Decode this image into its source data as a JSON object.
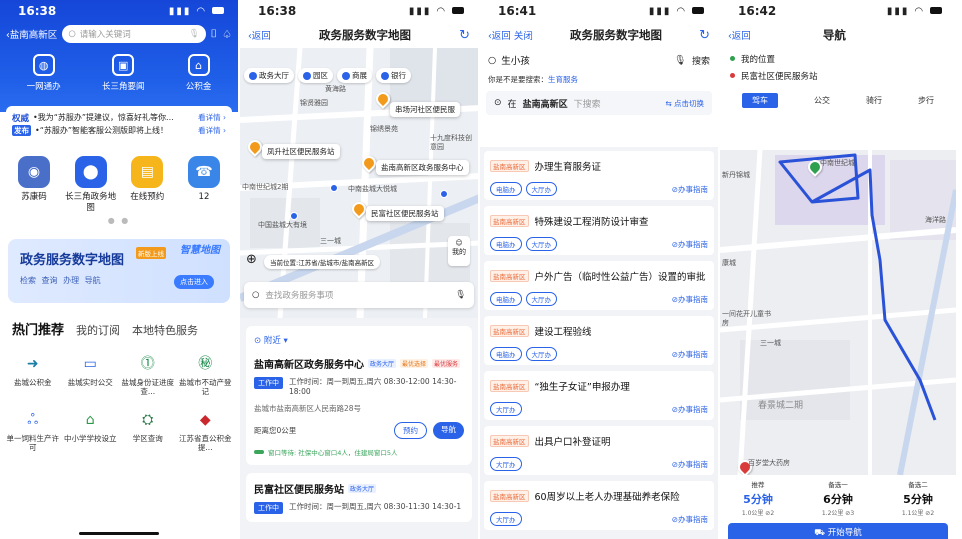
{
  "p1": {
    "time": "16:38",
    "region": "‹盐南高新区",
    "search_placeholder": "请输入关键词",
    "top_icons": [
      {
        "label": "一网通办",
        "icon": "globe-icon",
        "glyph": "◍"
      },
      {
        "label": "长三角要闻",
        "icon": "phone-news-icon",
        "glyph": "▣"
      },
      {
        "label": "公积金",
        "icon": "fund-icon",
        "glyph": "⌂"
      }
    ],
    "news": [
      {
        "tag": "权威",
        "text": "•我为“苏服办”提建议，惊喜好礼等你...",
        "link": "看详情 ›"
      },
      {
        "tag": "发布",
        "text": "•“苏服办”智能客服公测版即将上线！",
        "link": "看详情 ›"
      }
    ],
    "apps": [
      {
        "label": "苏康码",
        "color": "#4a6fc9",
        "glyph": "◉",
        "icon": "health-code-icon"
      },
      {
        "label": "长三角政务地图",
        "color": "#2a62e8",
        "glyph": "⬤",
        "icon": "map-icon"
      },
      {
        "label": "在线预约",
        "color": "#f5b51b",
        "glyph": "▤",
        "icon": "calendar-icon"
      },
      {
        "label": "12",
        "color": "#3a86e8",
        "glyph": "☎",
        "icon": "hotline-icon"
      }
    ],
    "banner": {
      "title": "政务服务数字地图",
      "tag": "新版上线",
      "sub": "检索 查询 办理 导航",
      "button": "点击进入",
      "logo": "智慧地图"
    },
    "tabs": [
      "热门推荐",
      "我的订阅",
      "本地特色服务"
    ],
    "grid": [
      {
        "label": "盐城公积金",
        "glyph": "➜",
        "color": "#1c7fa8",
        "icon": "fund-arrow-icon"
      },
      {
        "label": "盐城实时公交",
        "glyph": "▭",
        "color": "#2a62e8",
        "icon": "bus-icon"
      },
      {
        "label": "盐城身份证进度查...",
        "glyph": "⓵",
        "color": "#1a8a4a",
        "icon": "id-card-icon"
      },
      {
        "label": "盐城市不动产登记",
        "glyph": "㊙",
        "color": "#1a8a4a",
        "icon": "estate-icon"
      },
      {
        "label": "单一饲料生产许可",
        "glyph": "ஃ",
        "color": "#2a62e8",
        "icon": "feed-icon"
      },
      {
        "label": "中小学学校设立",
        "glyph": "⌂",
        "color": "#2a9a4a",
        "icon": "school-icon"
      },
      {
        "label": "学区查询",
        "glyph": "⛭",
        "color": "#2a7a4a",
        "icon": "district-icon"
      },
      {
        "label": "江苏省直公积金提...",
        "glyph": "◆",
        "color": "#c9282d",
        "icon": "province-fund-icon"
      }
    ]
  },
  "p2": {
    "time": "16:38",
    "back": "‹返回",
    "title": "政务服务数字地图",
    "filters": [
      "政务大厅",
      "园区",
      "商展",
      "银行"
    ],
    "map_labels": [
      "串场河社区便民服",
      "凤升社区便民服务站",
      "盐南高新区政务服务中心",
      "民富社区便民服务站"
    ],
    "pois": [
      "黄海路",
      "锦贤雅园",
      "锦绣景苑",
      "十九度科技创意园",
      "中南世纪城2期",
      "中南盐城大悦城",
      "中国盐城大有境",
      "三一城"
    ],
    "mine": "我的",
    "location": "当前位置:江苏省/盐城市/盐南高新区",
    "search_placeholder": "查找政务服务事项",
    "nearby": "附近 ▾",
    "cards": [
      {
        "name": "盐南高新区政务服务中心",
        "tags": [
          "政务大厅",
          "最优选择",
          "最优服务"
        ],
        "work_tag": "工作中",
        "hours": "工作时间：周一到周五,周六 08:30-12:00 14:30-18:00",
        "address": "盐城市盐南高新区人民南路28号",
        "distance": "距离您0公里",
        "btn1": "预约",
        "btn2": "导航",
        "queue": "窗口等待: 社保中心窗口4人，住建局窗口5人"
      },
      {
        "name": "民富社区便民服务站",
        "tags": [
          "政务大厅"
        ],
        "work_tag": "工作中",
        "hours": "工作时间：周一到周五,周六 08:30-11:30 14:30-1"
      }
    ]
  },
  "p3": {
    "time": "16:41",
    "back": "‹返回",
    "close": "关闭",
    "title": "政务服务数字地图",
    "query": "生小孩",
    "search_btn": "搜索",
    "suggest_prefix": "你是不是要搜索：",
    "suggest_term": "生育服务",
    "loc_prefix": "在",
    "loc_region": "盐南高新区",
    "loc_hint": "下搜索",
    "loc_switch": "⇆ 点击切换",
    "region_tag": "盐南高新区",
    "guide": "⊘办事指南",
    "items": [
      {
        "title": "办理生育服务证",
        "pills": [
          "电脑办",
          "大厅办"
        ]
      },
      {
        "title": "特殊建设工程消防设计审查",
        "pills": [
          "电脑办",
          "大厅办"
        ]
      },
      {
        "title": "户外广告（临时性公益广告）设置的审批",
        "pills": [
          "电脑办",
          "大厅办"
        ]
      },
      {
        "title": "建设工程验线",
        "pills": [
          "电脑办",
          "大厅办"
        ]
      },
      {
        "title": "“独生子女证”申报办理",
        "pills": [
          "大厅办"
        ]
      },
      {
        "title": "出具户口补登证明",
        "pills": [
          "大厅办"
        ]
      },
      {
        "title": "60周岁以上老人办理基础养老保险",
        "pills": [
          "大厅办"
        ]
      }
    ]
  },
  "p4": {
    "time": "16:42",
    "back": "‹返回",
    "title": "导航",
    "from": "我的位置",
    "to": "民富社区便民服务站",
    "modes": [
      "驾车",
      "公交",
      "骑行",
      "步行"
    ],
    "map_labels": [
      "新丹锦城",
      "中南世纪城",
      "康城",
      "一间花开儿童书房",
      "春景城二期",
      "百岁堂大药房",
      "海洋路",
      "三一城"
    ],
    "routes": [
      {
        "label": "推荐",
        "time": "5分钟",
        "sub": "1.0公里  ⊘2"
      },
      {
        "label": "备选一",
        "time": "6分钟",
        "sub": "1.2公里  ⊘3"
      },
      {
        "label": "备选二",
        "time": "5分钟",
        "sub": "1.1公里  ⊘2"
      }
    ],
    "start": "开始导航"
  }
}
